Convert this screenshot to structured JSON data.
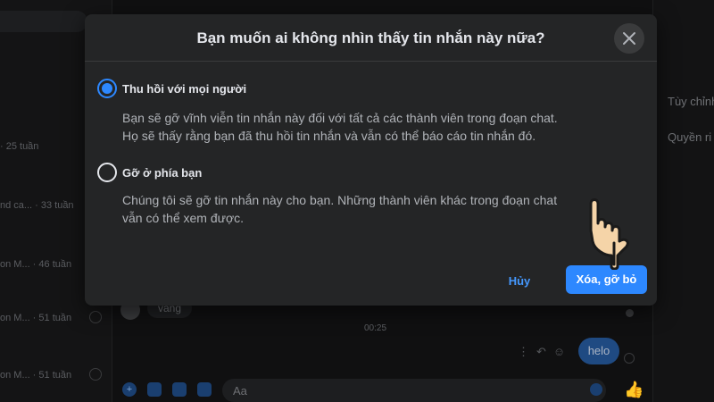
{
  "background": {
    "sidebar_rows": [
      {
        "text": "· 25 tuần"
      },
      {
        "text": "nd ca... · 33 tuần"
      },
      {
        "text": "on M... · 46 tuần"
      },
      {
        "text": "on M... · 51 tuần"
      },
      {
        "text": "on M... · 51 tuần"
      }
    ],
    "right_panel": {
      "customize": "Tùy chỉnh",
      "privacy": "Quyền ri"
    },
    "incoming_message": "vâng",
    "timestamp": "00:25",
    "outgoing_message": "helo",
    "composer_placeholder": "Aa"
  },
  "dialog": {
    "title": "Bạn muốn ai không nhìn thấy tin nhắn này nữa?",
    "options": [
      {
        "label": "Thu hồi với mọi người",
        "selected": true,
        "description": [
          "Bạn sẽ gỡ vĩnh viễn tin nhắn này đối với tất cả các thành viên trong đoạn chat.",
          "Họ sẽ thấy rằng bạn đã thu hồi tin nhắn và vẫn có thể báo cáo tin nhắn đó."
        ]
      },
      {
        "label": "Gỡ ở phía bạn",
        "selected": false,
        "description": [
          "Chúng tôi sẽ gỡ tin nhắn này cho bạn. Những thành viên khác trong đoạn chat",
          "vẫn có thể xem được."
        ]
      }
    ],
    "cancel_label": "Hủy",
    "confirm_label": "Xóa, gỡ bỏ"
  },
  "colors": {
    "accent": "#2d88ff",
    "dialog_bg": "#242526",
    "page_bg": "#101011"
  },
  "icons": [
    "close-icon",
    "pointing-hand-icon",
    "thumbs-up-icon"
  ]
}
